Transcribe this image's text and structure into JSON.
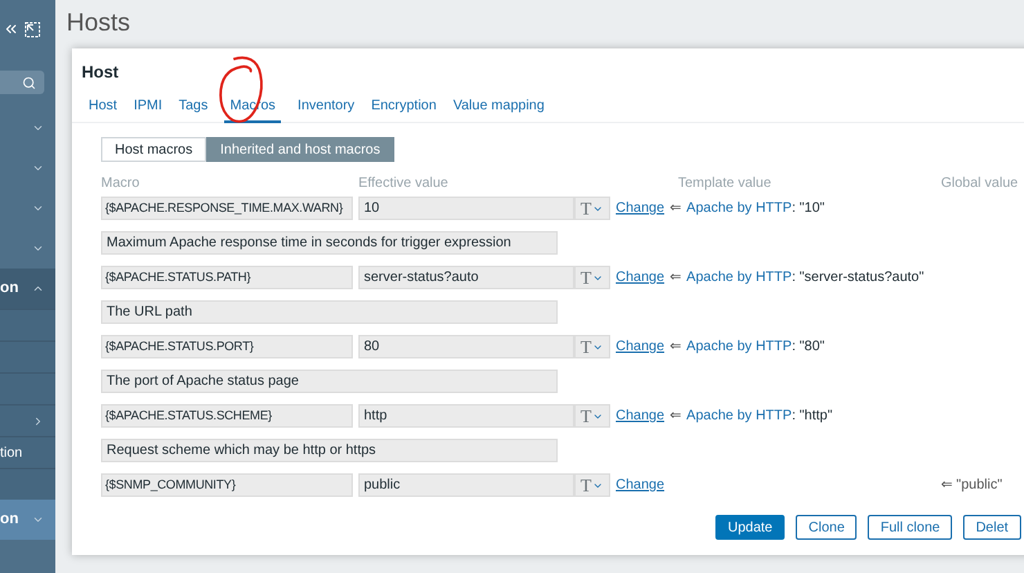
{
  "sidebar": {
    "items": [
      {
        "expanded": false
      },
      {
        "expanded": false
      },
      {
        "expanded": false
      },
      {
        "expanded": false
      },
      {
        "label": "on",
        "expanded": true,
        "children": [
          {
            "has_submenu": false
          },
          {
            "has_submenu": false
          },
          {
            "has_submenu": false
          },
          {
            "has_submenu": true
          },
          {
            "label": "tion",
            "has_submenu": false
          },
          {
            "has_submenu": false
          }
        ]
      },
      {
        "label": "on",
        "expanded": false
      }
    ]
  },
  "page_title": "Hosts",
  "dialog": {
    "title": "Host",
    "tabs": [
      {
        "label": "Host",
        "selected": false
      },
      {
        "label": "IPMI",
        "selected": false
      },
      {
        "label": "Tags",
        "selected": false
      },
      {
        "label": "Macros",
        "selected": true
      },
      {
        "label": "Inventory",
        "selected": false
      },
      {
        "label": "Encryption",
        "selected": false
      },
      {
        "label": "Value mapping",
        "selected": false
      }
    ],
    "macro_modes": [
      {
        "label": "Host macros",
        "selected": false
      },
      {
        "label": "Inherited and host macros",
        "selected": true
      }
    ],
    "columns": [
      "Macro",
      "Effective value",
      "Template value",
      "Global value"
    ],
    "macros": [
      {
        "macro": "{$APACHE.RESPONSE_TIME.MAX.WARN}",
        "value": "10",
        "type_icon": "T",
        "change": "Change",
        "inherit_arrow": "⇐",
        "template": "Apache by HTTP",
        "template_value": ": \"10\"",
        "description": "Maximum Apache response time in seconds for trigger expression"
      },
      {
        "macro": "{$APACHE.STATUS.PATH}",
        "value": "server-status?auto",
        "type_icon": "T",
        "change": "Change",
        "inherit_arrow": "⇐",
        "template": "Apache by HTTP",
        "template_value": ": \"server-status?auto\"",
        "description": "The URL path"
      },
      {
        "macro": "{$APACHE.STATUS.PORT}",
        "value": "80",
        "type_icon": "T",
        "change": "Change",
        "inherit_arrow": "⇐",
        "template": "Apache by HTTP",
        "template_value": ": \"80\"",
        "description": "The port of Apache status page"
      },
      {
        "macro": "{$APACHE.STATUS.SCHEME}",
        "value": "http",
        "type_icon": "T",
        "change": "Change",
        "inherit_arrow": "⇐",
        "template": "Apache by HTTP",
        "template_value": ": \"http\"",
        "description": "Request scheme which may be http or https"
      },
      {
        "macro": "{$SNMP_COMMUNITY}",
        "value": "public",
        "type_icon": "T",
        "change": "Change",
        "inherit_arrow": "⇐",
        "global_value": "\"public\""
      }
    ],
    "buttons": [
      {
        "label": "Update",
        "kind": "primary"
      },
      {
        "label": "Clone",
        "kind": "secondary"
      },
      {
        "label": "Full clone",
        "kind": "secondary"
      },
      {
        "label": "Delet",
        "kind": "secondary"
      }
    ]
  }
}
